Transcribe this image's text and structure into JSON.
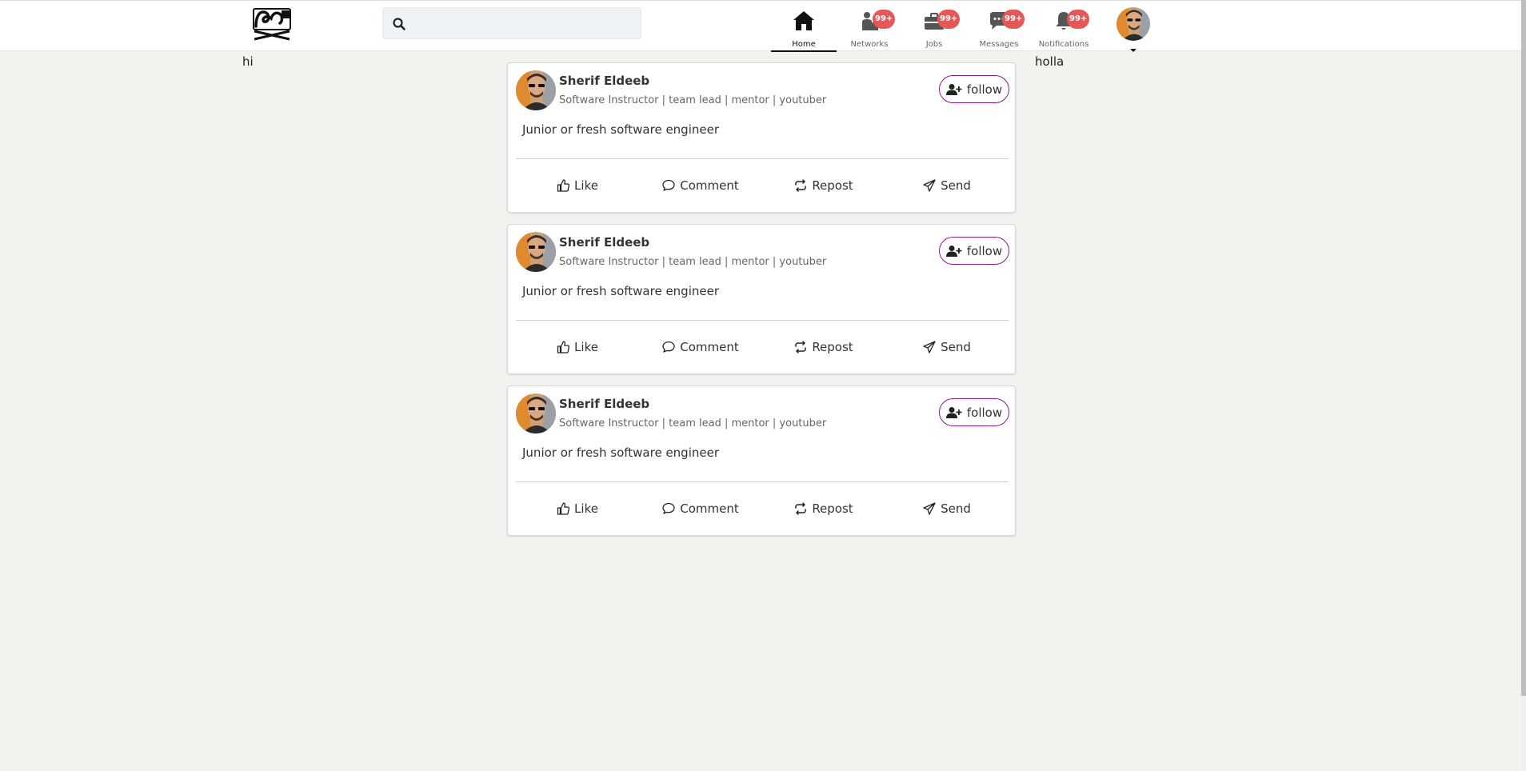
{
  "header": {
    "search": {
      "value": "",
      "placeholder": ""
    },
    "nav": [
      {
        "label": "Home",
        "icon": "home-icon",
        "badge": "",
        "active": true
      },
      {
        "label": "Networks",
        "icon": "people-icon",
        "badge": "99+"
      },
      {
        "label": "Jobs",
        "icon": "briefcase-icon",
        "badge": "99+"
      },
      {
        "label": "Messages",
        "icon": "chat-icon",
        "badge": "99+"
      },
      {
        "label": "Notifications",
        "icon": "bell-icon",
        "badge": "99+"
      }
    ]
  },
  "sidebar_left": {
    "text": "hi"
  },
  "sidebar_right": {
    "text": "holla"
  },
  "posts": [
    {
      "author": "Sherif Eldeeb",
      "headline": "Software Instructor | team lead | mentor | youtuber",
      "follow_label": "follow",
      "body": "Junior or fresh software engineer",
      "actions": [
        "Like",
        "Comment",
        "Repost",
        "Send"
      ]
    },
    {
      "author": "Sherif Eldeeb",
      "headline": "Software Instructor | team lead | mentor | youtuber",
      "follow_label": "follow",
      "body": "Junior or fresh software engineer",
      "actions": [
        "Like",
        "Comment",
        "Repost",
        "Send"
      ]
    },
    {
      "author": "Sherif Eldeeb",
      "headline": "Software Instructor | team lead | mentor | youtuber",
      "follow_label": "follow",
      "body": "Junior or fresh software engineer",
      "actions": [
        "Like",
        "Comment",
        "Repost",
        "Send"
      ]
    }
  ],
  "colors": {
    "accent": "#8a1a8f",
    "badge": "#e45858",
    "background": "#f3f2ef"
  }
}
